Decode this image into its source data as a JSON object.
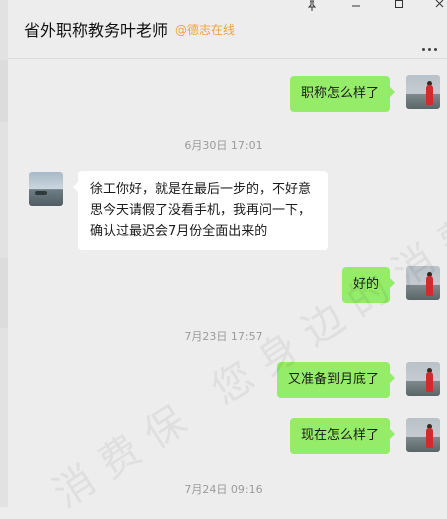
{
  "header": {
    "title": "省外职称教务叶老师",
    "tag": "@德志在线",
    "controls": {
      "pin": "pin-icon",
      "minimize": "minimize-icon",
      "maximize": "maximize-icon",
      "close": "close-icon"
    },
    "more_icon": "more-icon"
  },
  "timestamps": [
    "6月30日 17:01",
    "7月23日 17:57",
    "7月24日 09:16"
  ],
  "messages": [
    {
      "side": "me",
      "text": "职称怎么样了"
    },
    {
      "side": "other",
      "text": "徐工你好，就是在最后一步的，不好意思今天请假了没看手机，我再问一下，确认过最迟会7月份全面出来的"
    },
    {
      "side": "me",
      "text": "好的"
    },
    {
      "side": "me",
      "text": "又准备到月底了"
    },
    {
      "side": "me",
      "text": "现在怎么样了"
    }
  ],
  "watermark": "消费保 您身边的消费"
}
